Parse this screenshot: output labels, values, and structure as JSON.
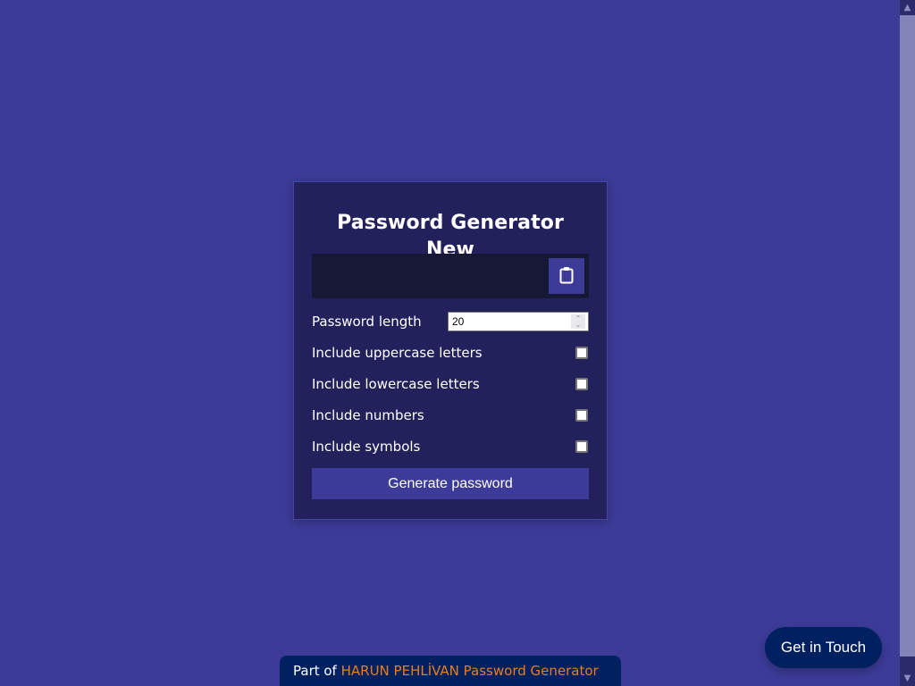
{
  "card": {
    "title": "Password Generator New",
    "result_value": "",
    "clipboard_icon": "clipboard-icon",
    "settings": {
      "length_label": "Password length",
      "length_value": "20",
      "uppercase_label": "Include uppercase letters",
      "uppercase_checked": false,
      "lowercase_label": "Include lowercase letters",
      "lowercase_checked": false,
      "numbers_label": "Include numbers",
      "numbers_checked": false,
      "symbols_label": "Include symbols",
      "symbols_checked": false
    },
    "generate_label": "Generate password"
  },
  "footer": {
    "prefix": "Part of ",
    "link_text": "HARUN PEHLİVAN Password Generator"
  },
  "contact": {
    "label": "Get in Touch"
  },
  "colors": {
    "background": "#3c3b98",
    "card": "#23215c",
    "result_box": "#171736",
    "button": "#3c3b98",
    "footer": "#01205f",
    "link": "#e87e1d"
  }
}
